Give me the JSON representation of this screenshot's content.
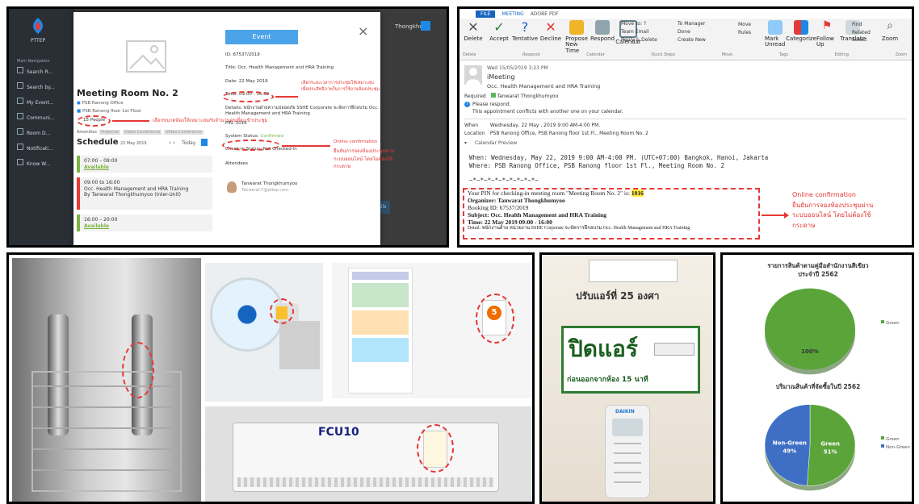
{
  "booking_app": {
    "logo_text": "PTTEP",
    "sidebar_title": "Main Navigation",
    "sidebar_items": [
      "Search R...",
      "Search by...",
      "My Event...",
      "Communi...",
      "Room D...",
      "Notificati...",
      "Know W..."
    ],
    "room_title": "Meeting Room No. 2",
    "room_location": "PSB Ranong Office",
    "room_floor": "PSB Ranong floor 1st Floor",
    "capacity": "15 People",
    "amenities_label": "Amenities",
    "amenities": [
      "Projector",
      "Video Conference",
      "Video Conference"
    ],
    "schedule_label": "Schedule",
    "schedule_date": "22 May 2019",
    "today_label": "Today",
    "slots": [
      {
        "time": "07:00 – 09:00",
        "status": "Available"
      },
      {
        "time": "09:00 to 16:00",
        "desc": "Occ. Health Management and HRA Training",
        "by": "By Tanwarat Thongkhumyoo (Inter-Unit)"
      },
      {
        "time": "16:00 – 20:00",
        "status": "Available"
      }
    ],
    "event_tab": "Event",
    "close_symbol": "×",
    "event_id": "ID: 67537/2019",
    "event_title": "Title: Occ. Health Management and HRA Training",
    "event_date": "Date: 22 May 2019",
    "event_time": "Time: 09:00 - 16:00",
    "event_details": "Details: พนักงานฝ่ายความปลอดภัย SSHE Corporate จะจัดการฝึกอบรม Occ. Health Management and HRA Training",
    "event_pin": "PIN: 1016",
    "event_status_label": "System Status:",
    "event_status_value": "Confirmed",
    "checkin_label": "Check-in Status: Not Checked-in",
    "attendees_label": "Attendees",
    "attendee_name": "Tanwarat Thongkhumyoo",
    "attendee_email": "Tanwarat.T@pttep.com",
    "top_right_text": "Thongkhu",
    "details_btn": "Details",
    "note_time": "เลือกระยะเวลาการประชุมให้เหมาะสม\nเพื่อประสิทธิภาพในการใช้งานห้องประชุม",
    "note_people": "เลือกขนาดห้องให้เหมาะสมกับจำนวนคนที่จะเข้าประชุม",
    "note_online_title": "Online confirmation",
    "note_online_body": "ยืนยันการจองห้องประชุมผ่าน\nระบบออนไลน์ โดยไม่ต้องใช้\nกระดาษ"
  },
  "outlook": {
    "tabs": [
      "FILE",
      "MEETING",
      "ADOBE PDF"
    ],
    "ribbon_groups": [
      "Delete",
      "Respond",
      "Calendar",
      "Quick Steps",
      "Move",
      "Tags",
      "Editing",
      "Zoom"
    ],
    "buttons_left": [
      "Delete",
      "Accept",
      "Tentative",
      "Decline",
      "Propose New Time",
      "Respond",
      "Calendar"
    ],
    "quick_steps": [
      "Move to: ?",
      "To Manager",
      "Team Email",
      "Done",
      "Reply & Delete",
      "Create New"
    ],
    "move_items": [
      "Move",
      "Rules"
    ],
    "tag_buttons": [
      "Mark Unread",
      "Categorize",
      "Follow Up"
    ],
    "edit_buttons": [
      "Translate",
      "Find",
      "Related",
      "Select"
    ],
    "zoom_label": "Zoom",
    "sent_date": "Wed 15/05/2019 3:23 PM",
    "sender": "iMeeting",
    "subject": "Occ. Health Management and HRA Training",
    "required_label": "Required",
    "required_name": "Tanwarat Thongkhumyoo",
    "please_respond": "Please respond.",
    "conflict_msg": "This appointment conflicts with another one on your calendar.",
    "when_label": "When",
    "when_value": "Wednesday, 22 May , 2019 9:00 AM-4:00 PM.",
    "location_label": "Location",
    "location_value": "PSB Ranong Office, PSB Ranong floor 1st Fl., Meeting Room No. 2",
    "calendar_preview": "Calendar Preview",
    "body_when": "When: Wednesday, May 22, 2019 9:00 AM-4:00 PM. (UTC+07:00) Bangkok, Hanoi, Jakarta",
    "body_where": "Where: PSB Ranong Office, PSB Ranong floor 1st Fl., Meeting Room No. 2",
    "tilde_line": "~*~*~*~*~*~*~*~*~*~",
    "pin_line_prefix": "Your PIN for checking-in meeting room \"Meeting Room No. 2\" is: ",
    "pin_value": "1016",
    "organizer": "Organizer: Tanwarat Thongkhumyoo",
    "booking_id": "Booking ID: 67537/2019",
    "subject_line": "Subject: Occ. Health Management and HRA Training",
    "time_line": "Time: 22 May 2019 09:00 - 16:00",
    "detail_line": "Detail: พนักงานฝ่าย หน่วยงาน SSHE Corporate จะจัดการฝึกอบรม Occ. Health Management and HRA Training",
    "note_title": "Online confirmation",
    "note_body": "ยืนยันการจองห้องประชุมผ่าน\nระบบออนไลน์ โดยไม่ต้องใช้\nกระดาษ"
  },
  "photos": {
    "fcu_label": "FCU10",
    "ac_sign": "ปรับแอร์ที่ 25 องศา",
    "off_sign_big": "ปิดแอร์",
    "off_sign_small": "ก่อนออกจากห้อง 15 นาที",
    "remote_brand": "DAIKIN",
    "energy_label": "5"
  },
  "chart_data": [
    {
      "type": "pie",
      "title": "รายการสินค้าตามคู่มือสำนักงานสีเขียว\nประจำปี 2562",
      "categories": [
        "Green"
      ],
      "values": [
        100
      ],
      "data_labels": [
        "100%"
      ],
      "colors": {
        "Green": "#5aa43a"
      },
      "legend_position": "right"
    },
    {
      "type": "pie",
      "title": "ปริมาณสินค้าที่จัดซื้อในปี 2562",
      "categories": [
        "Green",
        "Non-Green"
      ],
      "values": [
        51,
        49
      ],
      "data_labels": [
        "Green\n51%",
        "Non-Green\n49%"
      ],
      "colors": {
        "Green": "#5aa43a",
        "Non-Green": "#3f6fc4"
      },
      "legend_position": "right"
    }
  ]
}
